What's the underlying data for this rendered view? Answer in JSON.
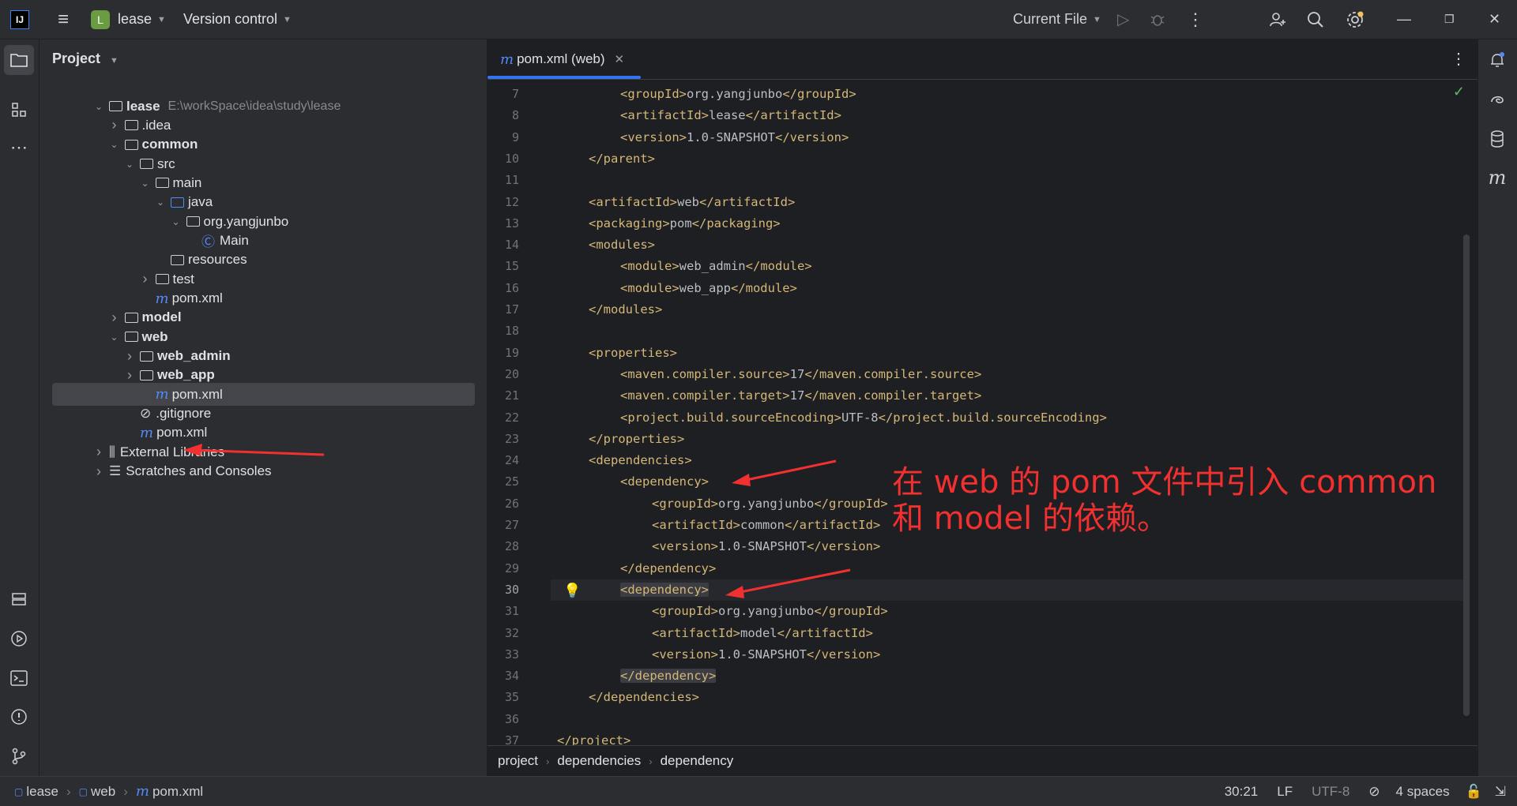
{
  "titlebar": {
    "logo": "IJ",
    "project_initial": "L",
    "project_name": "lease",
    "vcs": "Version control",
    "run_config": "Current File"
  },
  "project_panel": {
    "title": "Project",
    "tree": [
      {
        "label": "lease",
        "path": "E:\\workSpace\\idea\\study\\lease",
        "bold": true,
        "icon": "module-folder-icon",
        "expander": "open",
        "level": 0
      },
      {
        "label": ".idea",
        "icon": "folder-icon",
        "expander": "closed",
        "level": 1
      },
      {
        "label": "common",
        "bold": true,
        "icon": "module-folder-icon",
        "expander": "open",
        "level": 1
      },
      {
        "label": "src",
        "icon": "folder-icon",
        "expander": "open",
        "level": 2
      },
      {
        "label": "main",
        "icon": "folder-icon",
        "expander": "open",
        "level": 3
      },
      {
        "label": "java",
        "icon": "source-folder-icon",
        "expander": "open",
        "level": 4
      },
      {
        "label": "org.yangjunbo",
        "icon": "package-icon",
        "expander": "open",
        "level": 5
      },
      {
        "label": "Main",
        "icon": "class-icon",
        "expander": "none",
        "level": 6
      },
      {
        "label": "resources",
        "icon": "resources-folder-icon",
        "expander": "none",
        "level": 4
      },
      {
        "label": "test",
        "icon": "folder-icon",
        "expander": "closed",
        "level": 3
      },
      {
        "label": "pom.xml",
        "icon": "maven-icon",
        "expander": "none",
        "level": 3
      },
      {
        "label": "model",
        "bold": true,
        "icon": "module-folder-icon",
        "expander": "closed",
        "level": 1
      },
      {
        "label": "web",
        "bold": true,
        "icon": "module-folder-icon",
        "expander": "open",
        "level": 1
      },
      {
        "label": "web_admin",
        "bold": true,
        "icon": "module-folder-icon",
        "expander": "closed",
        "level": 2
      },
      {
        "label": "web_app",
        "bold": true,
        "icon": "module-folder-icon",
        "expander": "closed",
        "level": 2
      },
      {
        "label": "pom.xml",
        "icon": "maven-icon",
        "expander": "none",
        "level": 3,
        "selected": true
      },
      {
        "label": ".gitignore",
        "icon": "ignore-icon",
        "expander": "none",
        "level": 2
      },
      {
        "label": "pom.xml",
        "icon": "maven-icon",
        "expander": "none",
        "level": 2
      },
      {
        "label": "External Libraries",
        "icon": "library-icon",
        "expander": "closed",
        "level": 0
      },
      {
        "label": "Scratches and Consoles",
        "icon": "scratches-icon",
        "expander": "closed",
        "level": 0
      }
    ]
  },
  "editor": {
    "tab_label": "pom.xml (web)",
    "current_line": 30,
    "lines": [
      {
        "n": 7,
        "indent": 2,
        "open": "<groupId>",
        "text": "org.yangjunbo",
        "close": "</groupId>"
      },
      {
        "n": 8,
        "indent": 2,
        "open": "<artifactId>",
        "text": "lease",
        "close": "</artifactId>"
      },
      {
        "n": 9,
        "indent": 2,
        "open": "<version>",
        "text": "1.0-SNAPSHOT",
        "close": "</version>"
      },
      {
        "n": 10,
        "indent": 1,
        "open": "</parent>",
        "text": "",
        "close": ""
      },
      {
        "n": 11,
        "indent": 0,
        "open": "",
        "text": "",
        "close": ""
      },
      {
        "n": 12,
        "indent": 1,
        "open": "<artifactId>",
        "text": "web",
        "close": "</artifactId>"
      },
      {
        "n": 13,
        "indent": 1,
        "open": "<packaging>",
        "text": "pom",
        "close": "</packaging>"
      },
      {
        "n": 14,
        "indent": 1,
        "open": "<modules>",
        "text": "",
        "close": ""
      },
      {
        "n": 15,
        "indent": 2,
        "open": "<module>",
        "text": "web_admin",
        "close": "</module>"
      },
      {
        "n": 16,
        "indent": 2,
        "open": "<module>",
        "text": "web_app",
        "close": "</module>"
      },
      {
        "n": 17,
        "indent": 1,
        "open": "</modules>",
        "text": "",
        "close": ""
      },
      {
        "n": 18,
        "indent": 0,
        "open": "",
        "text": "",
        "close": ""
      },
      {
        "n": 19,
        "indent": 1,
        "open": "<properties>",
        "text": "",
        "close": ""
      },
      {
        "n": 20,
        "indent": 2,
        "open": "<maven.compiler.source>",
        "text": "17",
        "close": "</maven.compiler.source>"
      },
      {
        "n": 21,
        "indent": 2,
        "open": "<maven.compiler.target>",
        "text": "17",
        "close": "</maven.compiler.target>"
      },
      {
        "n": 22,
        "indent": 2,
        "open": "<project.build.sourceEncoding>",
        "text": "UTF-8",
        "close": "</project.build.sourceEncoding>"
      },
      {
        "n": 23,
        "indent": 1,
        "open": "</properties>",
        "text": "",
        "close": ""
      },
      {
        "n": 24,
        "indent": 1,
        "open": "<dependencies>",
        "text": "",
        "close": ""
      },
      {
        "n": 25,
        "indent": 2,
        "open": "<dependency>",
        "text": "",
        "close": ""
      },
      {
        "n": 26,
        "indent": 3,
        "open": "<groupId>",
        "text": "org.yangjunbo",
        "close": "</groupId>"
      },
      {
        "n": 27,
        "indent": 3,
        "open": "<artifactId>",
        "text": "common",
        "close": "</artifactId>"
      },
      {
        "n": 28,
        "indent": 3,
        "open": "<version>",
        "text": "1.0-SNAPSHOT",
        "close": "</version>"
      },
      {
        "n": 29,
        "indent": 2,
        "open": "</dependency>",
        "text": "",
        "close": ""
      },
      {
        "n": 30,
        "indent": 2,
        "open": "<dependency>",
        "text": "",
        "close": "",
        "hl": true
      },
      {
        "n": 31,
        "indent": 3,
        "open": "<groupId>",
        "text": "org.yangjunbo",
        "close": "</groupId>"
      },
      {
        "n": 32,
        "indent": 3,
        "open": "<artifactId>",
        "text": "model",
        "close": "</artifactId>"
      },
      {
        "n": 33,
        "indent": 3,
        "open": "<version>",
        "text": "1.0-SNAPSHOT",
        "close": "</version>"
      },
      {
        "n": 34,
        "indent": 2,
        "open": "</dependency>",
        "text": "",
        "close": "",
        "hl": true
      },
      {
        "n": 35,
        "indent": 1,
        "open": "</dependencies>",
        "text": "",
        "close": ""
      },
      {
        "n": 36,
        "indent": 0,
        "open": "",
        "text": "",
        "close": ""
      },
      {
        "n": 37,
        "indent": 0,
        "open": "</project>",
        "text": "",
        "close": ""
      }
    ],
    "breadcrumb": [
      "project",
      "dependencies",
      "dependency"
    ]
  },
  "annotation": {
    "line1": "在 web 的 pom 文件中引入 common",
    "line2": "和 model 的依赖。",
    "color": "#f23030"
  },
  "statusbar": {
    "crumbs": [
      "lease",
      "web",
      "pom.xml"
    ],
    "position": "30:21",
    "line_sep": "LF",
    "encoding": "UTF-8",
    "indent": "4 spaces"
  }
}
